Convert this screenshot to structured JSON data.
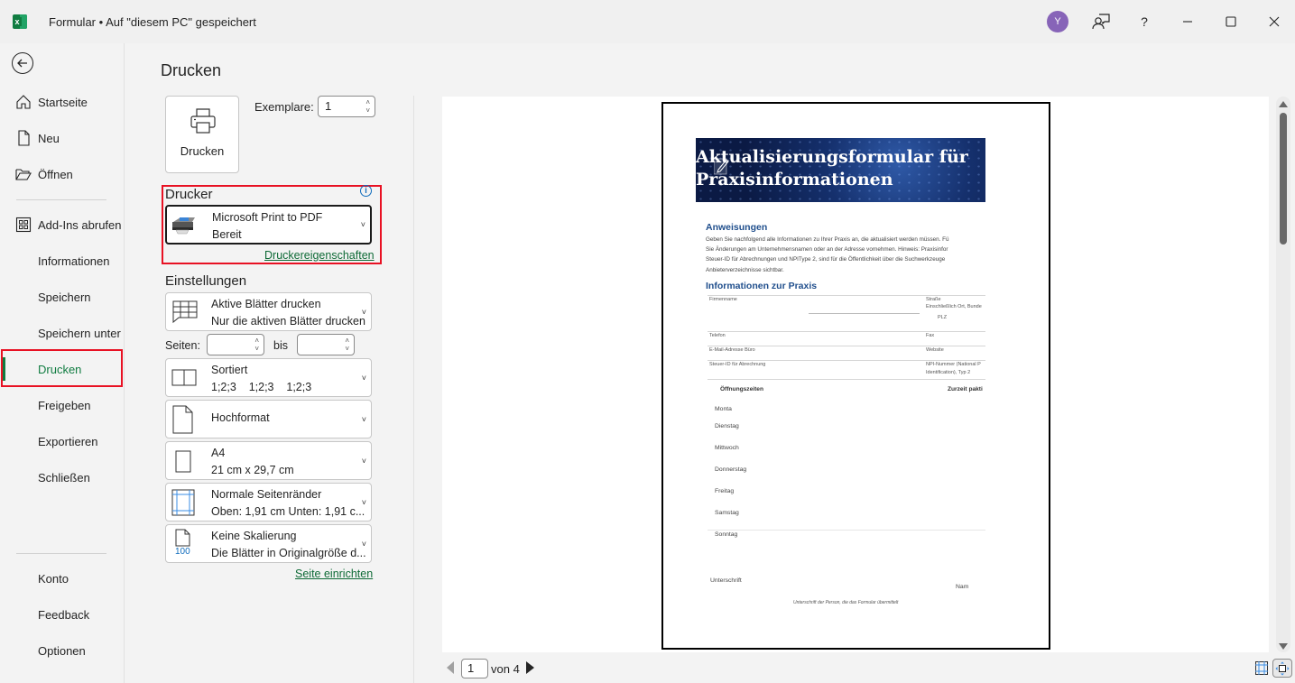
{
  "titlebar": {
    "app_icon": "excel-icon",
    "document_title": "Formular",
    "separator": "•",
    "save_status": "Auf \"diesem PC\" gespeichert",
    "avatar_initial": "Y",
    "icons": [
      "feedback-person-icon",
      "help-icon",
      "minimize-icon",
      "maximize-icon",
      "close-icon"
    ],
    "help_glyph": "?"
  },
  "leftnav": {
    "back_icon": "back-arrow-icon",
    "items": [
      {
        "label": "Startseite",
        "icon": "home-icon"
      },
      {
        "label": "Neu",
        "icon": "new-document-icon"
      },
      {
        "label": "Öffnen",
        "icon": "folder-open-icon"
      },
      {
        "label": "Add-Ins abrufen",
        "icon": "addins-grid-icon"
      },
      {
        "label": "Informationen"
      },
      {
        "label": "Speichern"
      },
      {
        "label": "Speichern unter"
      },
      {
        "label": "Drucken",
        "active": true
      },
      {
        "label": "Freigeben"
      },
      {
        "label": "Exportieren"
      },
      {
        "label": "Schließen"
      },
      {
        "label": "Konto"
      },
      {
        "label": "Feedback"
      },
      {
        "label": "Optionen"
      }
    ]
  },
  "print": {
    "heading": "Drucken",
    "print_button_label": "Drucken",
    "copies_label": "Exemplare:",
    "copies_value": "1",
    "printer_section": "Drucker",
    "printer_name": "Microsoft Print to PDF",
    "printer_status": "Bereit",
    "printer_properties_link": "Druckereigenschaften",
    "settings_section": "Einstellungen",
    "settings": {
      "what": {
        "title": "Aktive Blätter drucken",
        "subtitle": "Nur die aktiven Blätter drucken"
      },
      "pages_label": "Seiten:",
      "pages_from": "",
      "pages_to_label": "bis",
      "pages_to": "",
      "collation": {
        "title": "Sortiert",
        "subtitle": "1;2;3    1;2;3    1;2;3"
      },
      "orientation": {
        "title": "Hochformat"
      },
      "paper": {
        "title": "A4",
        "subtitle": "21 cm x 29,7 cm"
      },
      "margins": {
        "title": "Normale Seitenränder",
        "subtitle": "Oben: 1,91 cm Unten: 1,91 c..."
      },
      "scaling": {
        "title": "Keine Skalierung",
        "subtitle": "Die Blätter in Originalgröße d...",
        "icon_text": "100"
      }
    },
    "page_setup_link": "Seite einrichten"
  },
  "preview": {
    "doc": {
      "title_line1": "Aktualisierungsformular für",
      "title_line2": "Praxisinformationen",
      "instructions_heading": "Anweisungen",
      "instructions_lines": [
        "Geben Sie nachfolgend alle Informationen zu Ihrer Praxis an, die aktualisiert werden müssen. Fü",
        "Sie Änderungen am Unternehmensnamen oder an der Adresse vornehmen. Hinweis: Praxisinfor",
        "Steuer-ID für Abrechnungen und NPIType 2, sind für die Öffentlichkeit über die Suchwerkzeuge",
        "Anbieterverzeichnisse sichtbar."
      ],
      "info_heading": "Informationen zur Praxis",
      "fields": {
        "firmenname": "Firmenname",
        "strasse": "Straße",
        "strasse_sub": "Einschließlich Ort, Bunde",
        "plz": "PLZ",
        "telefon": "Telefon",
        "fax": "Fax",
        "email": "E-Mail-Adresse Büro",
        "website": "Website",
        "steuer": "Steuer-ID für Abrechnung",
        "npi": "NPI-Nummer (National P",
        "npi_sub": "Identification), Typ 2"
      },
      "hours_heading": "Öffnungszeiten",
      "hours_right": "Zurzeit pakti",
      "days": [
        "Monta",
        "Dienstag",
        "Mittwoch",
        "Donnerstag",
        "Freitag",
        "Samstag",
        "Sonntag"
      ],
      "signature": "Unterschrift",
      "name": "Nam",
      "signature_note": "Unterschrift der Person, die das Formular übermittelt"
    },
    "page_current": "1",
    "page_of": "von 4"
  }
}
